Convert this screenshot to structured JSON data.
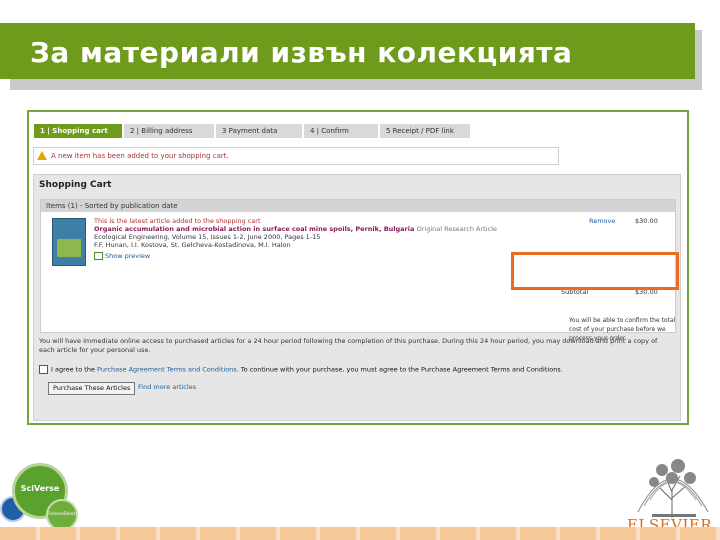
{
  "slide": {
    "title": "За материали извън колекцията"
  },
  "steps": [
    {
      "label": "1 | Shopping cart",
      "active": true
    },
    {
      "label": "2 | Billing address",
      "active": false
    },
    {
      "label": "3  Payment data",
      "active": false
    },
    {
      "label": "4 | Confirm",
      "active": false
    },
    {
      "label": "5  Receipt / PDF link",
      "active": false
    }
  ],
  "alert": {
    "text": "A new item has been added to your shopping cart."
  },
  "cart": {
    "title": "Shopping Cart",
    "items_header": "Items (1) - Sorted by publication date",
    "item": {
      "note": "This is the latest article added to the shopping cart",
      "title": "Organic accumulation and microbial action in surface coal mine spoils, Pernik, Bulgaria",
      "type": "Original Research Article",
      "journal": "Ecological Engineering, Volume 15, Issues 1-2, June 2000, Pages 1-15",
      "authors": "F.F. Hunan, I.I. Kostova, St. Gelcheva-Kostadinova, M.I. Halon",
      "preview": "Show preview",
      "remove": "Remove",
      "price": "$30.00"
    },
    "subtotal_label": "Subtotal",
    "subtotal_value": "$30.00",
    "confirm_note": "You will be able to confirm the total cost of your purchase before we process your order.",
    "access_text": "You will have immediate online access to purchased articles for a 24 hour period following the completion of this purchase. During this 24 hour period, you may download and print a copy of each article for your personal use.",
    "agree_prefix": "I agree to the ",
    "agree_link": "Purchase Agreement Terms and Conditions",
    "agree_suffix": ". To continue with your purchase, you must agree to the Purchase Agreement Terms and Conditions.",
    "purchase_button": "Purchase These Articles",
    "find_link": "Find more articles"
  },
  "logos": {
    "sciverse": "SciVerse",
    "sciencedirect": "ScienceDirect",
    "elsevier": "ELSEVIER"
  },
  "colors": {
    "brand_green": "#6f9b1c",
    "highlight_orange": "#e86d1f",
    "elsevier_orange": "#e06a10"
  }
}
